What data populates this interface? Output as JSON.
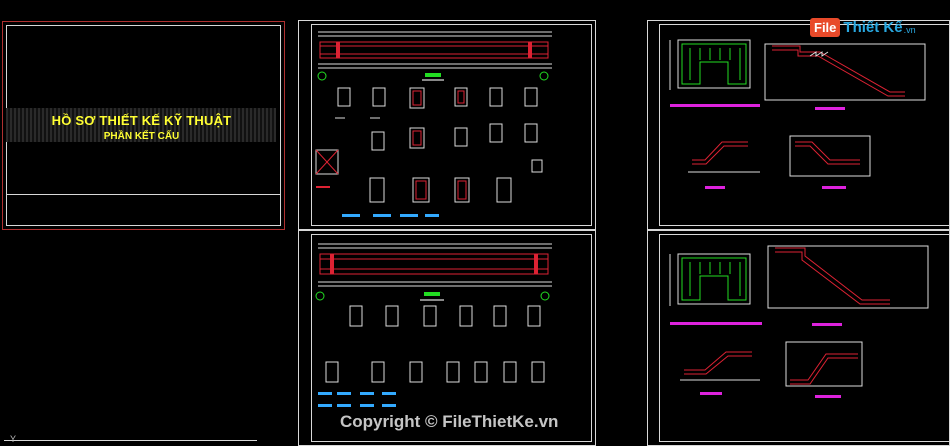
{
  "cover": {
    "title": "HỒ SƠ THIẾT KẾ KỸ THUẬT",
    "subtitle": "PHẦN KẾT CẤU"
  },
  "watermark": {
    "text": "Copyright © FileThietKe.vn"
  },
  "logo": {
    "box_text": "File",
    "rest_text": "Thiết Kế",
    "suffix": ".vn",
    "box_color": "#e84a2a",
    "text_color": "#29a8e0"
  },
  "ucs": {
    "axis_label": "Y"
  },
  "colors": {
    "background": "#000000",
    "frame": "#d8d8d8",
    "cover_border": "#b03030",
    "cover_text": "#ffff33"
  }
}
